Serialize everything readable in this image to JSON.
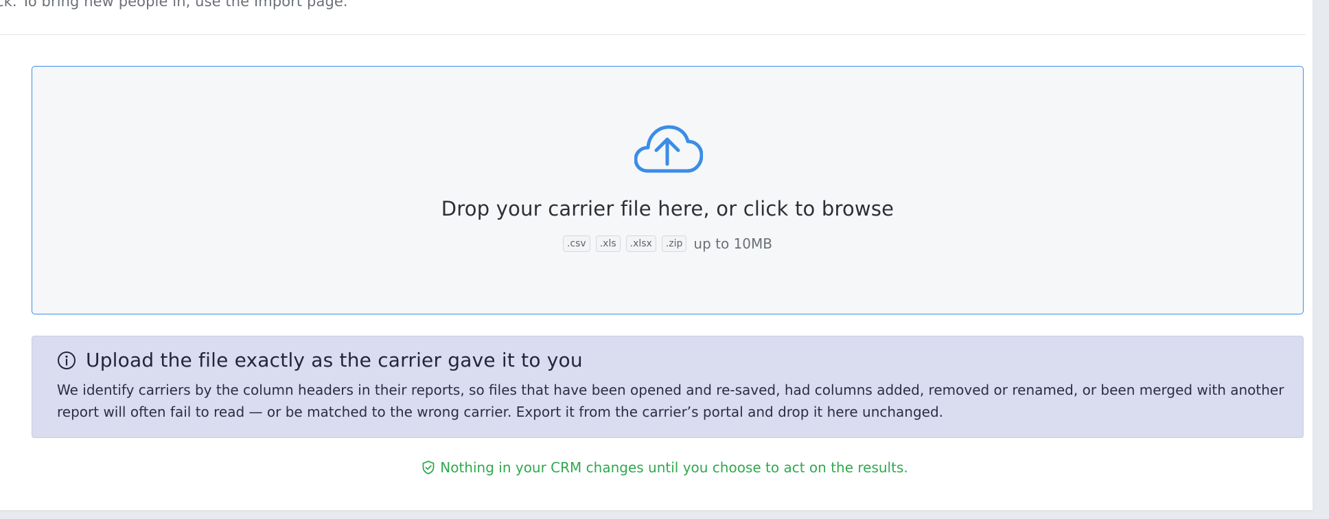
{
  "intro": {
    "text": "ck. To bring new people in, use the Import page."
  },
  "dropzone": {
    "icon": "cloud-upload-icon",
    "title": "Drop your carrier file here, or click to browse",
    "file_types": [
      ".csv",
      ".xls",
      ".xlsx",
      ".zip"
    ],
    "size_note": "up to 10MB"
  },
  "notice": {
    "icon": "info-icon",
    "title": "Upload the file exactly as the carrier gave it to you",
    "body": "We identify carriers by the column headers in their reports, so files that have been opened and re-saved, had columns added, removed or renamed, or been merged with another report will often fail to read — or be matched to the wrong carrier. Export it from the carrier’s portal and drop it here unchanged."
  },
  "assurance": {
    "icon": "shield-check-icon",
    "text": "Nothing in your CRM changes until you choose to act on the results."
  },
  "colors": {
    "accent": "#3b8de6",
    "notice_bg": "#dadcef",
    "success": "#2fa84f"
  }
}
